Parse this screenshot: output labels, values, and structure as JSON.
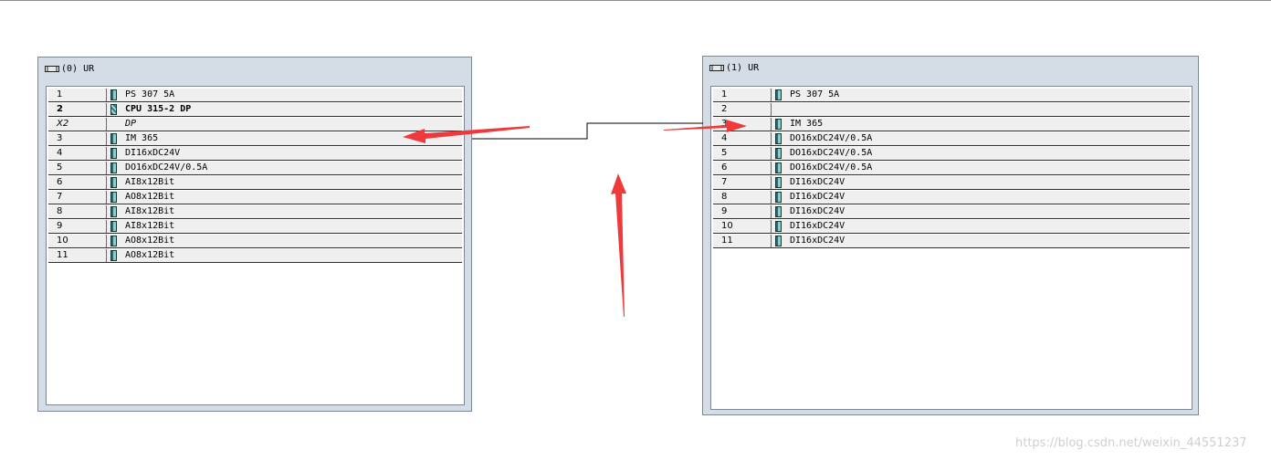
{
  "racks": [
    {
      "title": "(0) UR",
      "rows": [
        {
          "slot": "1",
          "module": "PS 307 5A",
          "style": "normal",
          "icon": true
        },
        {
          "slot": "2",
          "module": "CPU 315-2 DP",
          "style": "bold",
          "icon": true,
          "cpu": true
        },
        {
          "slot": "X2",
          "module": "DP",
          "style": "italic",
          "icon": false
        },
        {
          "slot": "3",
          "module": "IM 365",
          "style": "normal",
          "icon": true
        },
        {
          "slot": "4",
          "module": "DI16xDC24V",
          "style": "normal",
          "icon": true
        },
        {
          "slot": "5",
          "module": "DO16xDC24V/0.5A",
          "style": "normal",
          "icon": true
        },
        {
          "slot": "6",
          "module": "AI8x12Bit",
          "style": "normal",
          "icon": true
        },
        {
          "slot": "7",
          "module": "AO8x12Bit",
          "style": "normal",
          "icon": true
        },
        {
          "slot": "8",
          "module": "AI8x12Bit",
          "style": "normal",
          "icon": true
        },
        {
          "slot": "9",
          "module": "AI8x12Bit",
          "style": "normal",
          "icon": true
        },
        {
          "slot": "10",
          "module": "AO8x12Bit",
          "style": "normal",
          "icon": true
        },
        {
          "slot": "11",
          "module": "AO8x12Bit",
          "style": "normal",
          "icon": true
        }
      ]
    },
    {
      "title": "(1) UR",
      "rows": [
        {
          "slot": "1",
          "module": "PS 307 5A",
          "style": "normal",
          "icon": true
        },
        {
          "slot": "2",
          "module": "",
          "style": "normal",
          "icon": false
        },
        {
          "slot": "3",
          "module": "IM 365",
          "style": "normal",
          "icon": true
        },
        {
          "slot": "4",
          "module": "DO16xDC24V/0.5A",
          "style": "normal",
          "icon": true
        },
        {
          "slot": "5",
          "module": "DO16xDC24V/0.5A",
          "style": "normal",
          "icon": true
        },
        {
          "slot": "6",
          "module": "DO16xDC24V/0.5A",
          "style": "normal",
          "icon": true
        },
        {
          "slot": "7",
          "module": "DI16xDC24V",
          "style": "normal",
          "icon": true
        },
        {
          "slot": "8",
          "module": "DI16xDC24V",
          "style": "normal",
          "icon": true
        },
        {
          "slot": "9",
          "module": "DI16xDC24V",
          "style": "normal",
          "icon": true
        },
        {
          "slot": "10",
          "module": "DI16xDC24V",
          "style": "normal",
          "icon": true
        },
        {
          "slot": "11",
          "module": "DI16xDC24V",
          "style": "normal",
          "icon": true
        }
      ]
    }
  ],
  "watermark": "https://blog.csdn.net/weixin_44551237",
  "colors": {
    "frame": "#d4dce6",
    "row": "#efefef",
    "annotation_arrow": "#ee3a3a",
    "connection_line": "#000000"
  }
}
